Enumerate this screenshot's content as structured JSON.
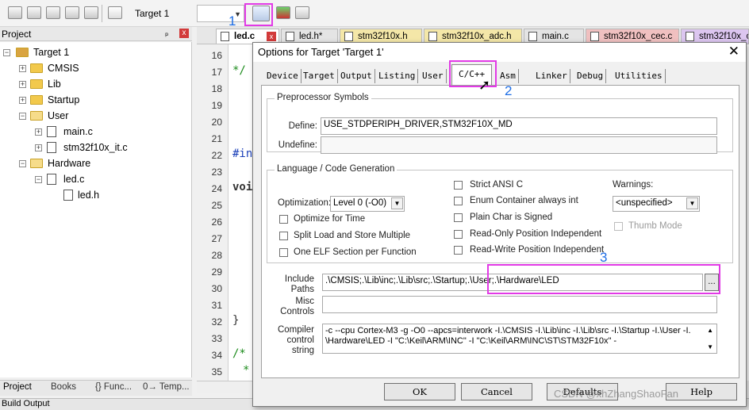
{
  "toolbar": {
    "target": "Target 1"
  },
  "annotations": {
    "step1": "1",
    "step2": "2",
    "step3": "3"
  },
  "project_panel": {
    "title": "Project",
    "pin": "ₚ",
    "close": "x"
  },
  "tree": {
    "root": "Target 1",
    "cmsis": "CMSIS",
    "lib": "Lib",
    "startup": "Startup",
    "user": "User",
    "main_c": "main.c",
    "it_c": "stm32f10x_it.c",
    "hardware": "Hardware",
    "led_c": "led.c",
    "led_h": "led.h"
  },
  "left_tabs": {
    "project": "Project",
    "books": "Books",
    "funcs": "{} Func...",
    "templates": "0→ Temp..."
  },
  "editor_tabs": [
    "led.c",
    "led.h*",
    "stm32f10x.h",
    "stm32f10x_adc.h",
    "main.c",
    "stm32f10x_cec.c",
    "stm32f10x_c"
  ],
  "lines": [
    "16",
    "17",
    "18",
    "19",
    "20",
    "21",
    "22",
    "23",
    "24",
    "25",
    "26",
    "27",
    "28",
    "29",
    "30",
    "31",
    "32",
    "33",
    "34",
    "35"
  ],
  "code": {
    "l17": "*/",
    "l22": "#in",
    "l24": "voi",
    "l32": "}",
    "l34": "/*",
    "l35": "*"
  },
  "build_output": "Build Output",
  "dialog": {
    "title": "Options for Target 'Target 1'",
    "close": "✕",
    "tabs": [
      "Device",
      "Target",
      "Output",
      "Listing",
      "User",
      "C/C++",
      "Asm",
      "Linker",
      "Debug",
      "Utilities"
    ],
    "pre_title": "Preprocessor Symbols",
    "define_label": "Define:",
    "define_value": "USE_STDPERIPH_DRIVER,STM32F10X_MD",
    "undefine_label": "Undefine:",
    "undefine_value": "",
    "lang_title": "Language / Code Generation",
    "strict": "Strict ANSI C",
    "enum": "Enum Container always int",
    "plain": "Plain Char is Signed",
    "ropi": "Read-Only Position Independent",
    "rwpi": "Read-Write Position Independent",
    "opt_label": "Optimization:",
    "opt_value": "Level 0 (-O0)",
    "opt_time": "Optimize for Time",
    "split": "Split Load and Store Multiple",
    "elf": "One ELF Section per Function",
    "warn_label": "Warnings:",
    "warn_value": "<unspecified>",
    "thumb": "Thumb Mode",
    "include_label1": "Include",
    "include_label2": "Paths",
    "include_value": ".\\CMSIS;.\\Lib\\inc;.\\Lib\\src;.\\Startup;.\\User;.\\Hardware\\LED",
    "browse": "...",
    "misc_label1": "Misc",
    "misc_label2": "Controls",
    "misc_value": "",
    "compiler_label1": "Compiler",
    "compiler_label2": "control",
    "compiler_label3": "string",
    "compiler_line1": "-c --cpu Cortex-M3 -g -O0 --apcs=interwork -I.\\CMSIS -I.\\Lib\\inc -I.\\Lib\\src -I.\\Startup -I.\\User -I.",
    "compiler_line2": "\\Hardware\\LED -I \"C:\\Keil\\ARM\\INC\" -I \"C:\\Keil\\ARM\\INC\\ST\\STM32F10x\" -",
    "ok": "OK",
    "cancel": "Cancel",
    "defaults": "Defaults",
    "help": "Help"
  },
  "watermark": "CSDN @xhZhangShaoFan"
}
